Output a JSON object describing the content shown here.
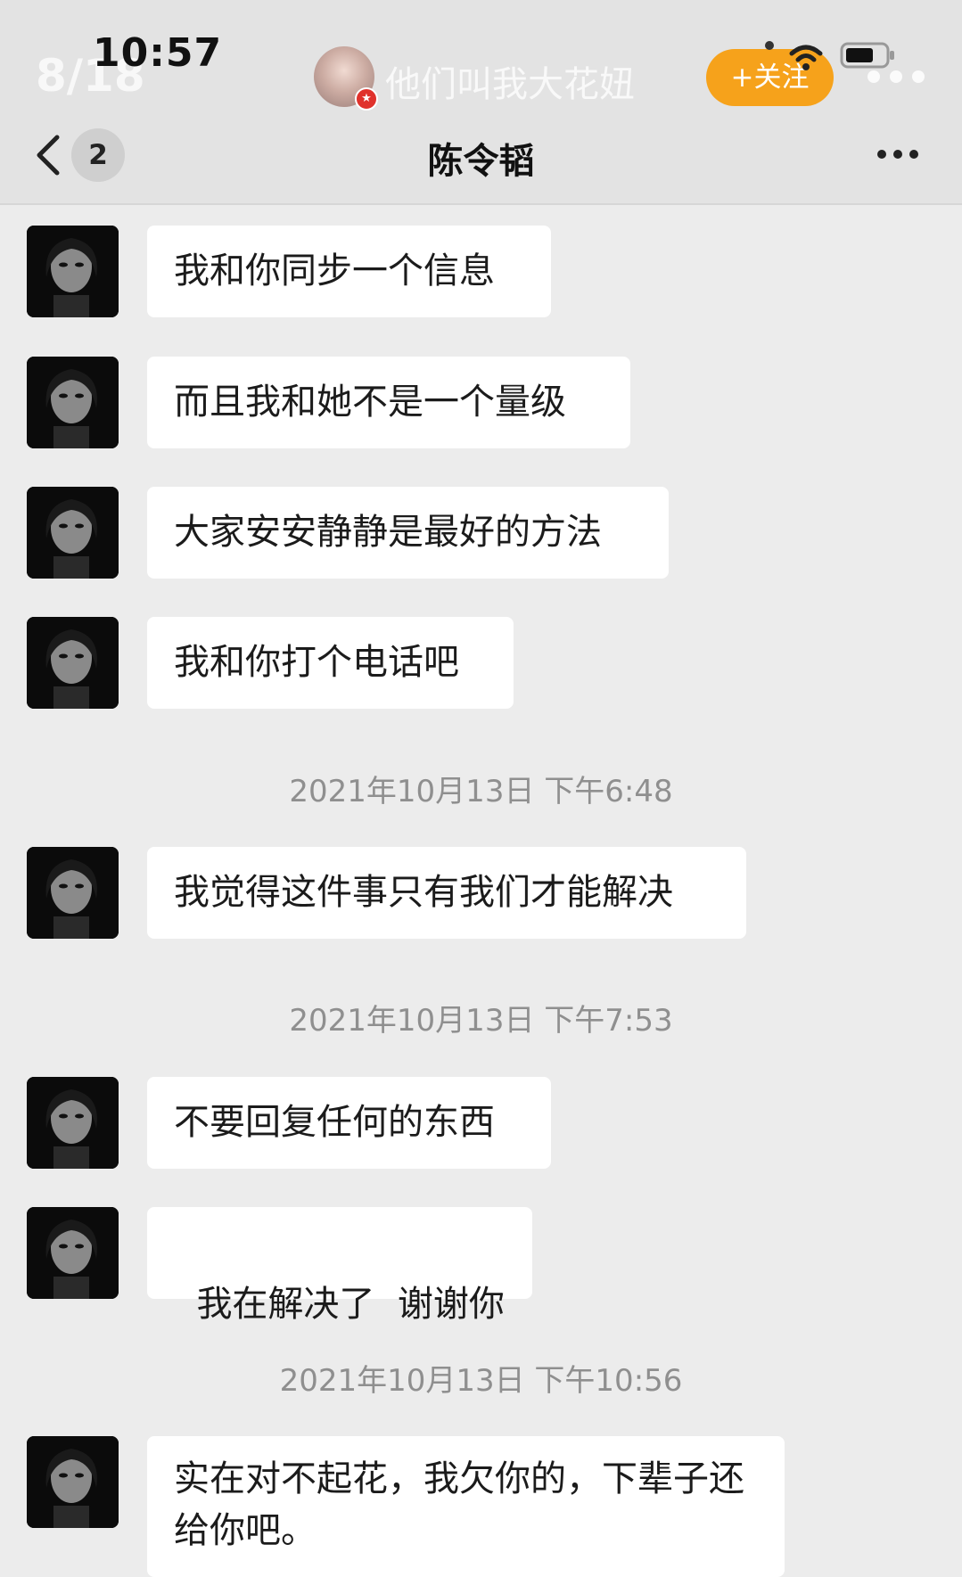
{
  "status_bar": {
    "time": "10:57",
    "counter": "8/18"
  },
  "poster": {
    "name": "他们叫我大花妞",
    "follow_label": "+关注"
  },
  "nav": {
    "unread_count": "2",
    "title": "陈令韬"
  },
  "messages": [
    {
      "text": "我和你同步一个信息"
    },
    {
      "text": "而且我和她不是一个量级"
    },
    {
      "text": "大家安安静静是最好的方法"
    },
    {
      "text": "我和你打个电话吧"
    },
    {
      "text": "我觉得这件事只有我们才能解决"
    },
    {
      "text": "不要回复任何的东西"
    },
    {
      "text": "我在解决了  谢谢你"
    },
    {
      "text": "实在对不起花，我欠你的，下辈子还给你吧。"
    }
  ],
  "timestamps": [
    "2021年10月13日 下午6:48",
    "2021年10月13日 下午7:53",
    "2021年10月13日 下午10:56"
  ],
  "colors": {
    "background": "#ececec",
    "header": "#e3e3e3",
    "bubble": "#ffffff",
    "follow_button": "#f6a21b",
    "timestamp": "#8f8f8f"
  }
}
